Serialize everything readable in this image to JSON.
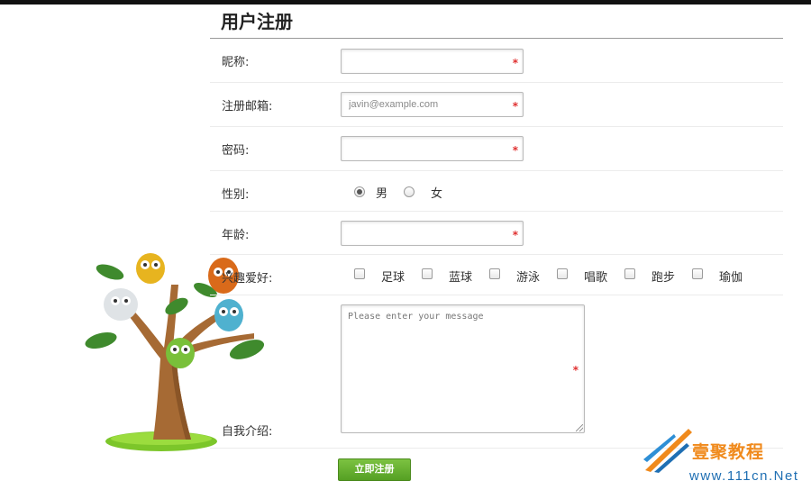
{
  "form": {
    "title": "用户注册",
    "fields": {
      "nickname": {
        "label": "昵称:",
        "value": "",
        "placeholder": ""
      },
      "email": {
        "label": "注册邮箱:",
        "value": "",
        "placeholder": "javin@example.com"
      },
      "password": {
        "label": "密码:",
        "value": "",
        "placeholder": ""
      },
      "age": {
        "label": "年龄:",
        "value": "",
        "placeholder": ""
      }
    },
    "required_mark": "*",
    "gender": {
      "label": "性别:",
      "options": [
        "男",
        "女"
      ],
      "selected": "男"
    },
    "hobbies": {
      "label": "兴趣爱好:",
      "options": [
        "足球",
        "蓝球",
        "游泳",
        "唱歌",
        "跑步",
        "瑜伽"
      ]
    },
    "intro": {
      "label": "自我介绍:",
      "placeholder": "Please enter your message"
    },
    "submit_label": "立即注册"
  },
  "watermark": {
    "text": "壹聚教程",
    "domain": "www.111cn.Net"
  },
  "colors": {
    "button_green": "#5ba82b",
    "required_red": "#e03030",
    "watermark_orange": "#f08a1c",
    "watermark_blue": "#1f6fb3"
  }
}
